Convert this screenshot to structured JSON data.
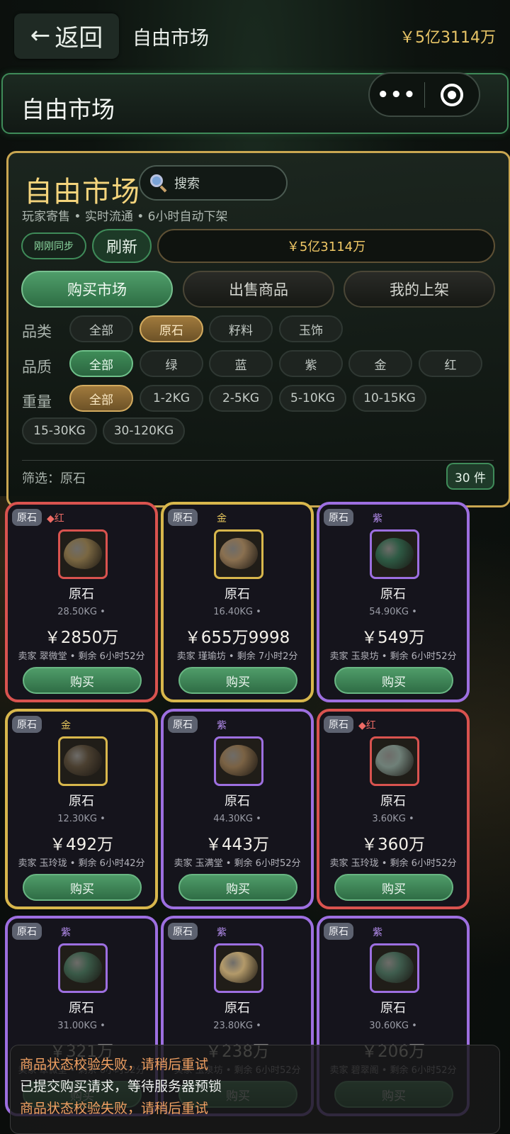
{
  "topbar": {
    "back_label": "返回",
    "title": "自由市场",
    "balance": "￥5亿3114万"
  },
  "header_bar": {
    "title": "自由市场"
  },
  "panel": {
    "title": "自由市场",
    "search_placeholder": "搜索",
    "subtitle": "玩家寄售 • 实时流通 • 6小时自动下架",
    "sync_status": "刚刚同步",
    "refresh_label": "刷新",
    "balance": "￥5亿3114万",
    "tabs": [
      {
        "label": "购买市场",
        "active": true
      },
      {
        "label": "出售商品",
        "active": false
      },
      {
        "label": "我的上架",
        "active": false
      }
    ],
    "filters": {
      "category": {
        "label": "品类",
        "options": [
          "全部",
          "原石",
          "籽料",
          "玉饰"
        ],
        "selected": "原石"
      },
      "quality": {
        "label": "品质",
        "options": [
          "全部",
          "绿",
          "蓝",
          "紫",
          "金",
          "红"
        ],
        "selected": "全部"
      },
      "weight": {
        "label": "重量",
        "options": [
          "全部",
          "1-2KG",
          "2-5KG",
          "5-10KG",
          "10-15KG",
          "15-30KG",
          "30-120KG"
        ],
        "selected": "全部"
      }
    },
    "filter_summary": "筛选：原石",
    "count": "30 件"
  },
  "items": [
    {
      "tag": "原石",
      "quality": "◆红",
      "rarity": "red",
      "name": "原石",
      "weight": "28.50KG •",
      "price": "￥2850万",
      "seller": "卖家 翠微堂 • 剩余 6小时52分",
      "buy": "购买",
      "stone_color": "#7a6742"
    },
    {
      "tag": "原石",
      "quality": "金",
      "rarity": "gold",
      "name": "原石",
      "weight": "16.40KG •",
      "price": "￥655万9998",
      "seller": "卖家 瑾瑜坊 • 剩余 7小时2分",
      "buy": "购买",
      "stone_color": "#8a7050"
    },
    {
      "tag": "原石",
      "quality": "紫",
      "rarity": "purple",
      "name": "原石",
      "weight": "54.90KG •",
      "price": "￥549万",
      "seller": "卖家 玉泉坊 • 剩余 6小时52分",
      "buy": "购买",
      "stone_color": "#2e5a44"
    },
    {
      "tag": "原石",
      "quality": "金",
      "rarity": "gold",
      "name": "原石",
      "weight": "12.30KG •",
      "price": "￥492万",
      "seller": "卖家 玉玲珑 • 剩余 6小时42分",
      "buy": "购买",
      "stone_color": "#4a3f30"
    },
    {
      "tag": "原石",
      "quality": "紫",
      "rarity": "purple",
      "name": "原石",
      "weight": "44.30KG •",
      "price": "￥443万",
      "seller": "卖家 玉满堂 • 剩余 6小时52分",
      "buy": "购买",
      "stone_color": "#7a6244"
    },
    {
      "tag": "原石",
      "quality": "◆红",
      "rarity": "red",
      "name": "原石",
      "weight": "3.60KG •",
      "price": "￥360万",
      "seller": "卖家 玉玲珑 • 剩余 6小时52分",
      "buy": "购买",
      "stone_color": "#6f8078"
    },
    {
      "tag": "原石",
      "quality": "紫",
      "rarity": "purple",
      "name": "原石",
      "weight": "31.00KG •",
      "price": "￥321万",
      "seller": "卖家 翠微堂 • 剩余 6小时52分",
      "buy": "购买",
      "stone_color": "#3a5a48"
    },
    {
      "tag": "原石",
      "quality": "紫",
      "rarity": "purple",
      "name": "原石",
      "weight": "23.80KG •",
      "price": "￥238万",
      "seller": "卖家 玉泉坊 • 剩余 6小时52分",
      "buy": "购买",
      "stone_color": "#b39a6a"
    },
    {
      "tag": "原石",
      "quality": "紫",
      "rarity": "purple",
      "name": "原石",
      "weight": "30.60KG •",
      "price": "￥206万",
      "seller": "卖家 碧翠阁 • 剩余 6小时52分",
      "buy": "购买",
      "stone_color": "#3f5d4e"
    }
  ],
  "toast": [
    {
      "text": "商品状态校验失败，请稍后重试",
      "type": "err"
    },
    {
      "text": "已提交购买请求，等待服务器预锁",
      "type": "ok"
    },
    {
      "text": "商品状态校验失败，请稍后重试",
      "type": "err"
    }
  ]
}
